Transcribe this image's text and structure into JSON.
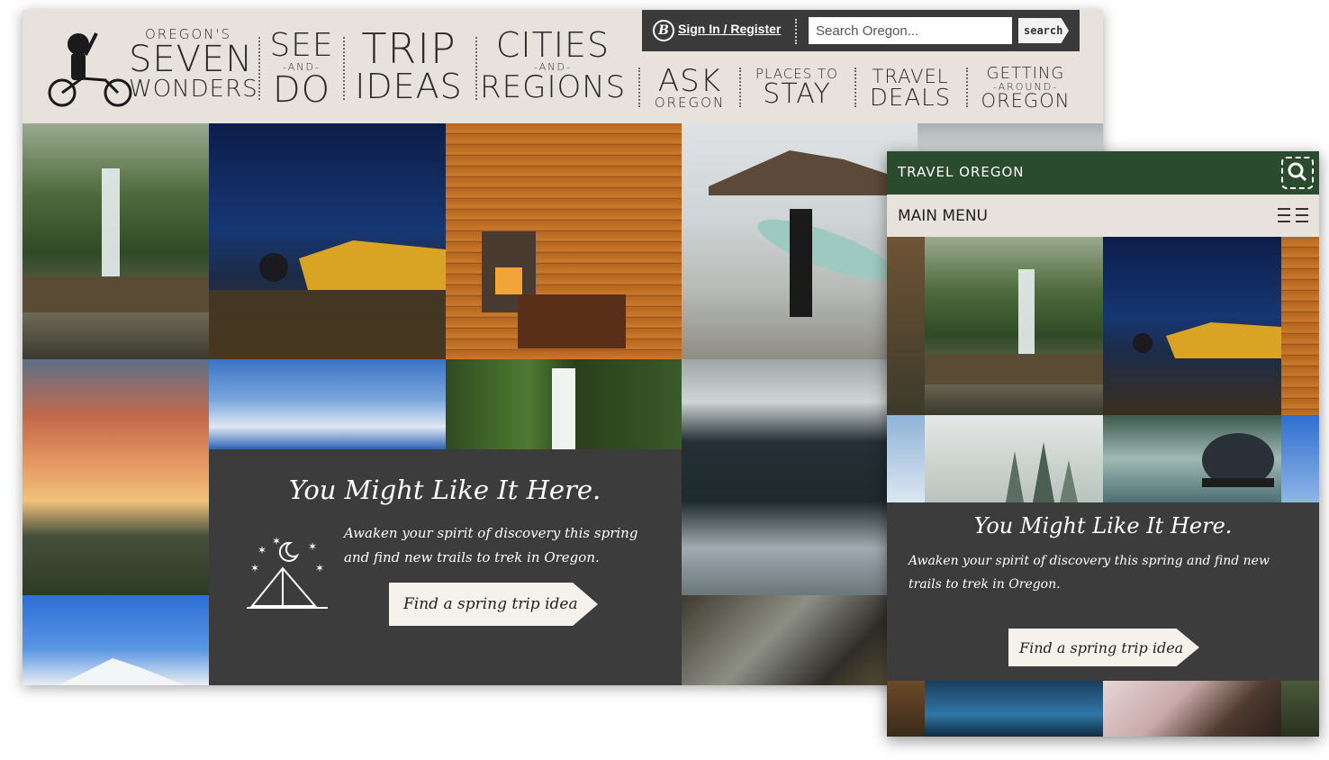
{
  "desktop": {
    "header": {
      "logo": "travel-oregon-bicyclist-logo",
      "nav": [
        {
          "pre": "OREGON'S",
          "main": "SEVEN",
          "post": "WONDERS"
        },
        {
          "pre": "SEE",
          "mid": "-AND-",
          "main": "DO"
        },
        {
          "main": "TRIP",
          "post": "IDEAS"
        },
        {
          "pre": "CITIES",
          "mid": "-AND-",
          "main": "REGIONS"
        },
        {
          "main": "ASK",
          "post": "OREGON"
        },
        {
          "pre": "PLACES TO",
          "main": "STAY"
        },
        {
          "pre": "TRAVEL",
          "main": "DEALS"
        },
        {
          "pre": "GETTING",
          "mid": "-AROUND-",
          "main": "OREGON"
        }
      ],
      "util": {
        "signin": "Sign In / Register",
        "search_placeholder": "Search Oregon...",
        "search_button": "search"
      }
    },
    "promo": {
      "title": "You Might Like It Here.",
      "body": "Awaken your spirit of discovery this spring and find new trails to trek in Oregon.",
      "cta": "Find a spring trip idea"
    }
  },
  "mobile": {
    "header_title": "TRAVEL OREGON",
    "menu_label": "MAIN MENU",
    "promo": {
      "title": "You Might Like It Here.",
      "body": "Awaken your spirit of discovery this spring and find new trails to trek in Oregon.",
      "cta": "Find a spring trip idea"
    }
  },
  "colors": {
    "header_bg": "#e7e2dc",
    "dark_panel": "#3c3c3c",
    "mobile_green": "#2b4b2e"
  }
}
